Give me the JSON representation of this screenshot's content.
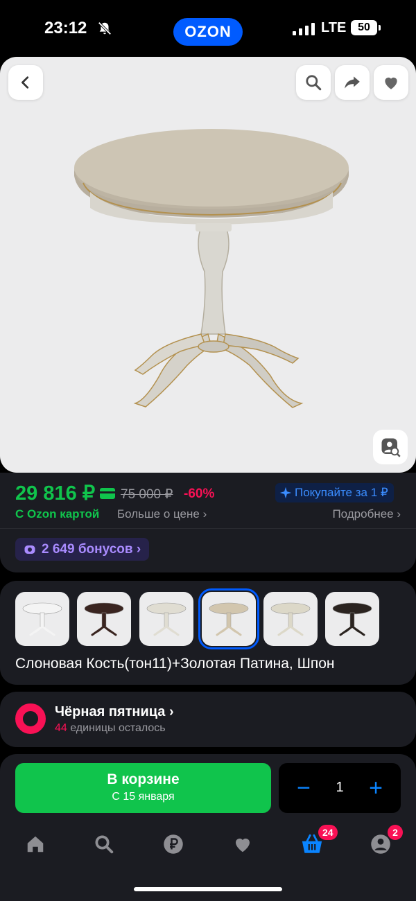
{
  "status_bar": {
    "time": "23:12",
    "network": "LTE",
    "battery": "50",
    "logo": "OZON"
  },
  "gallery": {
    "product_image": "oval pedestal dining table"
  },
  "price": {
    "current": "29 816 ₽",
    "old": "75 000 ₽",
    "discount": "-60%",
    "buy_for_1": "Покупайте за 1 ₽",
    "ozon_card": "С Ozon картой",
    "more_about_price": "Больше о цене ›",
    "details": "Подробнее ›",
    "bonus": "2 649 бонусов ›"
  },
  "variants": {
    "name": "Слоновая Кость(тон11)+Золотая Патина, Шпон",
    "thumbnails": [
      {
        "color": "#f4f4f4",
        "selected": false
      },
      {
        "color": "#3a2520",
        "selected": false
      },
      {
        "color": "#e0ddd2",
        "selected": false
      },
      {
        "color": "#d2c6ae",
        "selected": true
      },
      {
        "color": "#dcd8c8",
        "selected": false
      },
      {
        "color": "#2b2420",
        "selected": false
      }
    ]
  },
  "promo": {
    "title": "Чёрная пятница ›",
    "count": "44",
    "remaining_text": " единицы осталось"
  },
  "cart": {
    "button_label": "В корзине",
    "delivery": "С 15 января",
    "quantity": "1",
    "minus": "−",
    "plus": "+"
  },
  "tabbar": {
    "items": [
      "home-icon",
      "search-icon",
      "ruble-icon",
      "heart-icon",
      "basket-icon",
      "profile-icon"
    ],
    "cart_badge": "24",
    "profile_badge": "2"
  },
  "colors": {
    "accent_green": "#10c44c",
    "brand_blue": "#005bff",
    "sale_pink": "#f91155",
    "card_bg": "#1b1c22"
  }
}
